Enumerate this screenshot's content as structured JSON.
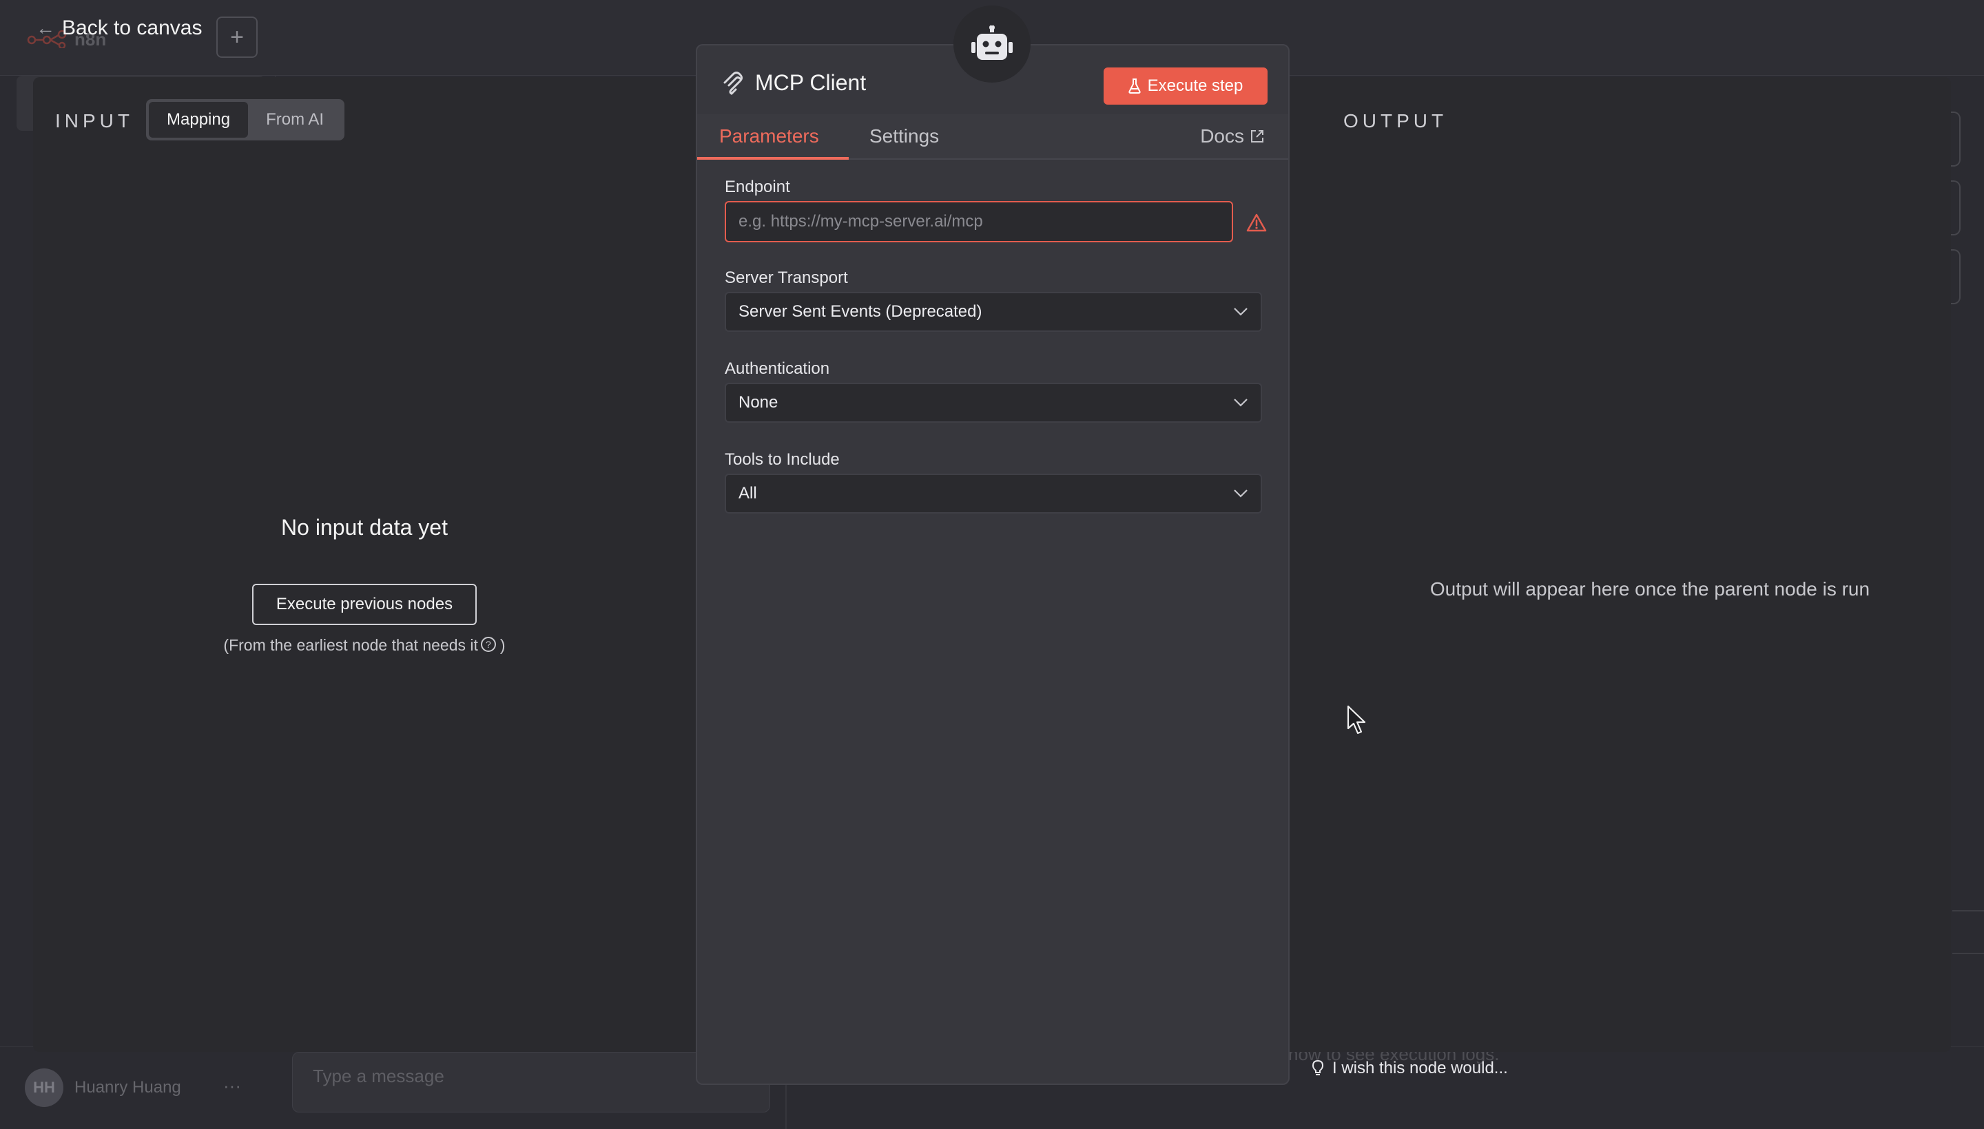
{
  "app": {
    "back_label": "Back to canvas",
    "plus_label": "+",
    "logo_text": "n8n"
  },
  "input_panel": {
    "title": "INPUT",
    "modes": [
      "Mapping",
      "From AI"
    ],
    "active_mode": "Mapping",
    "empty_title": "No input data yet",
    "execute_previous_label": "Execute previous nodes",
    "hint_before": "(From the earliest node that needs it",
    "hint_after": ")"
  },
  "node": {
    "title": "MCP Client",
    "execute_step_label": "Execute step",
    "tabs": {
      "parameters": "Parameters",
      "settings": "Settings",
      "docs": "Docs"
    },
    "fields": {
      "endpoint": {
        "label": "Endpoint",
        "value": "",
        "placeholder": "e.g. https://my-mcp-server.ai/mcp"
      },
      "server_transport": {
        "label": "Server Transport",
        "value": "Server Sent Events (Deprecated)"
      },
      "authentication": {
        "label": "Authentication",
        "value": "None"
      },
      "tools_to_include": {
        "label": "Tools to Include",
        "value": "All"
      }
    }
  },
  "output_panel": {
    "title": "OUTPUT",
    "message": "Output will appear here once the parent node is run"
  },
  "footer": {
    "wish_label": "I wish this node would...",
    "logs_hint": "now to see execution logs.",
    "chat_placeholder": "Type a message",
    "user_initials": "HH",
    "user_name": "Huanry Huang",
    "user_more": "···"
  },
  "colors": {
    "accent": "#ea5c4b",
    "panel_bg": "#2a2a2e",
    "params_bg": "#37373d"
  }
}
